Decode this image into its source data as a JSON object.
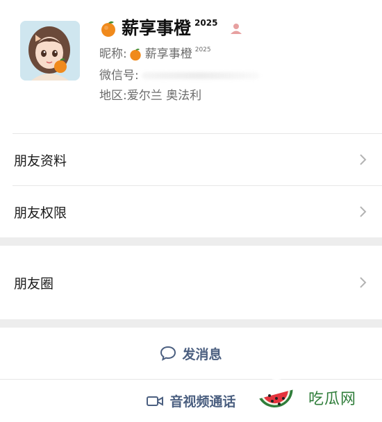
{
  "profile": {
    "display_name": "薪享事橙",
    "display_name_sup": "2025",
    "nickname_label": "昵称:",
    "nickname_value": "薪享事橙",
    "nickname_sup": "2025",
    "wechat_id_label": "微信号:",
    "region_label": "地区:",
    "region_value": "爱尔兰 奥法利"
  },
  "menu": {
    "items": [
      {
        "label": "朋友资料"
      },
      {
        "label": "朋友权限"
      },
      {
        "label": "朋友圈"
      }
    ]
  },
  "actions": {
    "message_label": "发消息",
    "call_label": "音视频通话"
  },
  "watermark": {
    "text": "吃瓜网"
  },
  "colors": {
    "action_text": "#4b5f80",
    "section_gap": "#ededed",
    "person_icon": "#e7a0a0",
    "watermark_green": "#2f7d3a"
  }
}
